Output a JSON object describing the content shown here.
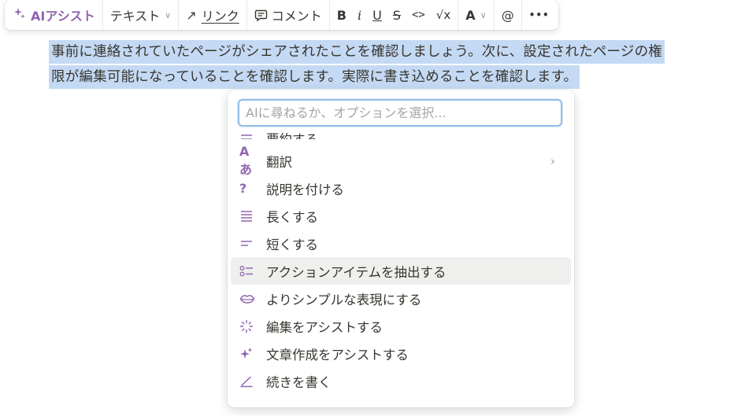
{
  "toolbar": {
    "ai_label": "AIアシスト",
    "text_label": "テキスト",
    "link_label": "リンク",
    "comment_label": "コメント",
    "bold": "B",
    "italic": "i",
    "underline": "U",
    "strike": "S",
    "code": "<>",
    "math": "√x",
    "color": "A",
    "mention": "@",
    "more": "•••"
  },
  "paragraph": {
    "line1": "事前に連絡されていたページがシェアされたことを確認しましょう。次に、設定されたページの権",
    "line2": "限が編集可能になっていることを確認します。実際に書き込めることを確認します。"
  },
  "ai_menu": {
    "placeholder": "AIに尋ねるか、オプションを選択...",
    "items": [
      {
        "label": "要約する",
        "icon": "summarize-icon"
      },
      {
        "label": "翻訳",
        "icon": "translate-icon",
        "has_submenu": true
      },
      {
        "label": "説明を付ける",
        "icon": "question-icon"
      },
      {
        "label": "長くする",
        "icon": "lengthen-icon"
      },
      {
        "label": "短くする",
        "icon": "shorten-icon"
      },
      {
        "label": "アクションアイテムを抽出する",
        "icon": "checklist-icon",
        "highlighted": true
      },
      {
        "label": "よりシンプルな表現にする",
        "icon": "lips-icon"
      },
      {
        "label": "編集をアシストする",
        "icon": "sparkle-burst-icon"
      },
      {
        "label": "文章作成をアシストする",
        "icon": "sparkles-icon"
      },
      {
        "label": "続きを書く",
        "icon": "pen-icon"
      }
    ]
  },
  "colors": {
    "accent": "#9065b0",
    "selection": "#c4d9f3",
    "input_focus": "#94bde6",
    "hover": "#efefed"
  }
}
